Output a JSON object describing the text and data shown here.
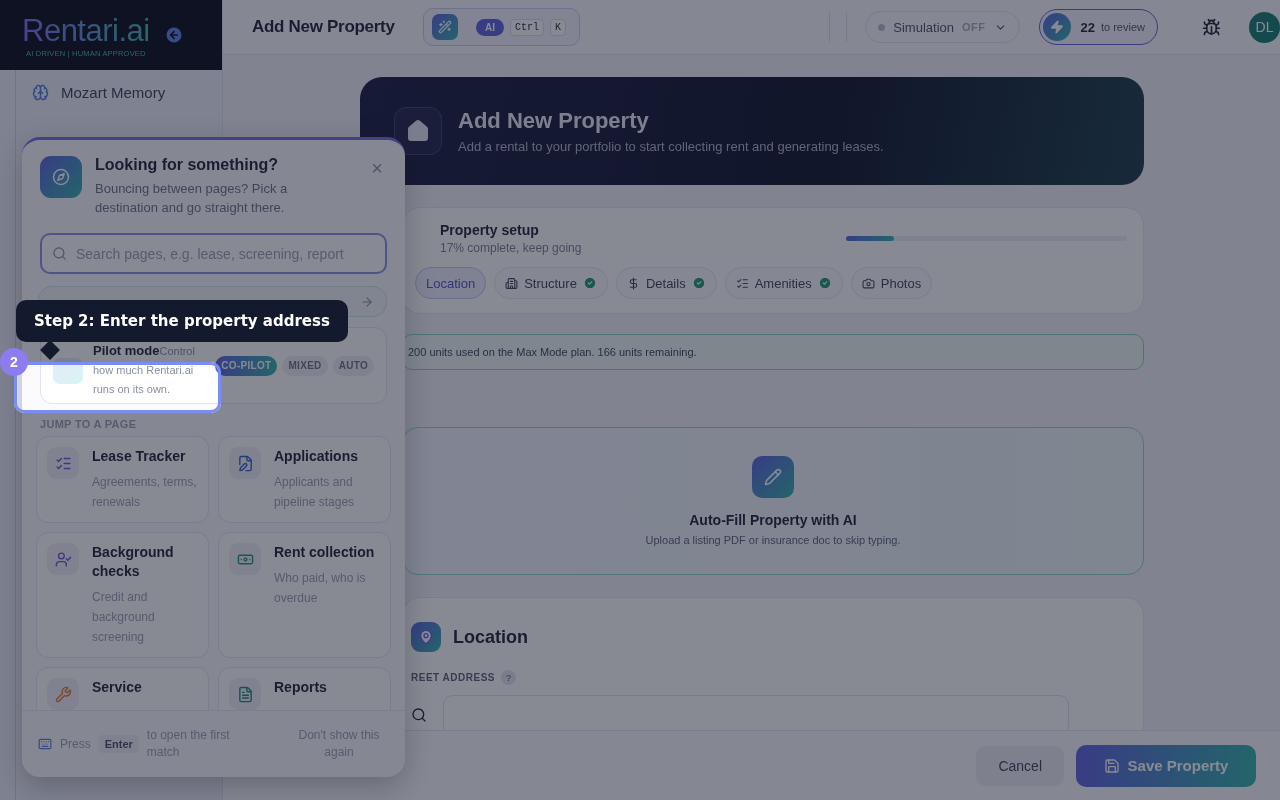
{
  "sidebar": {
    "logo": "Rentari.ai",
    "tagline": "AI DRIVEN | HUMAN APPROVED",
    "items": [
      {
        "label": "Mozart Memory"
      }
    ]
  },
  "header": {
    "title": "Add New Property",
    "command": {
      "ai": "AI",
      "keys": [
        "Ctrl",
        "K"
      ]
    },
    "simulation": {
      "label": "Simulation",
      "state": "OFF",
      "on": false
    },
    "review": {
      "count": "22",
      "label": "to review"
    },
    "avatar": "DL"
  },
  "hero": {
    "title": "Add New Property",
    "subtitle": "Add a rental to your portfolio to start collecting rent and generating leases."
  },
  "setup": {
    "title": "Property setup",
    "subtitle": "17% complete, keep going",
    "level": 0.17,
    "tabs": [
      {
        "label": "Location",
        "kind": "location",
        "selected": true,
        "done": false
      },
      {
        "label": "Structure",
        "kind": "structure",
        "selected": false,
        "done": true
      },
      {
        "label": "Details",
        "kind": "details",
        "selected": false,
        "done": true
      },
      {
        "label": "Amenities",
        "kind": "amenities",
        "selected": false,
        "done": true
      },
      {
        "label": "Photos",
        "kind": "photos",
        "selected": false,
        "done": false
      }
    ]
  },
  "notice": "200 units used on the Max Mode plan. 166 units remaining.",
  "autofill": {
    "title": "Auto-Fill Property with AI",
    "subtitle": "Upload a listing PDF or insurance doc to skip typing."
  },
  "location": {
    "title": "Location",
    "field_label": "REET ADDRESS",
    "help": "?"
  },
  "footer": {
    "cancel": "Cancel",
    "save": "Save Property"
  },
  "popover": {
    "title": "Looking for something?",
    "subtitle": "Bouncing between pages? Pick a destination and go straight there.",
    "close": "×",
    "search": {
      "placeholder": "Search pages, e.g. lease, screening, report"
    },
    "pilot": {
      "text": "**Pilot mode**Control how much Rentari.ai runs on its own.",
      "modes": [
        {
          "label": "CO-PILOT",
          "selected": true
        },
        {
          "label": "MIXED",
          "selected": false
        },
        {
          "label": "AUTO",
          "selected": false
        }
      ]
    },
    "section": "JUMP TO A PAGE",
    "pages": [
      {
        "title": "Lease Tracker",
        "desc": "Agreements, terms, renewals",
        "kind": "lease"
      },
      {
        "title": "Applications",
        "desc": "Applicants and pipeline stages",
        "kind": "applications"
      },
      {
        "title": "Background checks",
        "desc": "Credit and background screening",
        "kind": "background"
      },
      {
        "title": "Rent collection",
        "desc": "Who paid, who is overdue",
        "kind": "rent"
      },
      {
        "title": "Service",
        "kind": "service"
      },
      {
        "title": "Reports",
        "kind": "reports"
      }
    ],
    "hint": {
      "press": "Press",
      "key": "Enter",
      "rest": "to open the first match"
    },
    "dismiss": "Don't show this again"
  },
  "tour": {
    "step": "2",
    "text": "Step 2: Enter the property address"
  }
}
